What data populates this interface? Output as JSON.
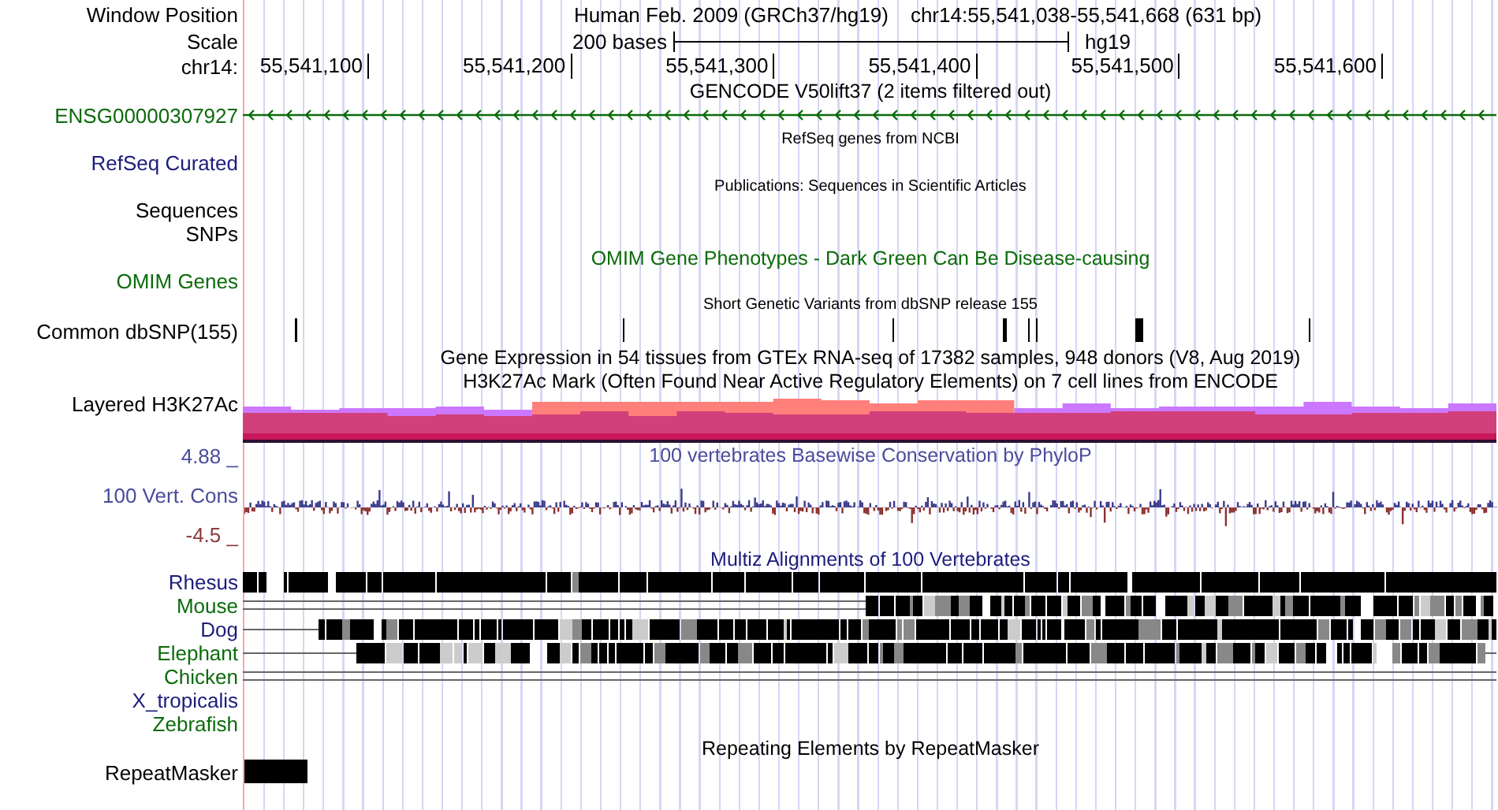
{
  "header": {
    "window_position_label": "Window Position",
    "assembly": "Human Feb. 2009 (GRCh37/hg19)",
    "position": "chr14:55,541,038-55,541,668 (631 bp)",
    "scale_label": "Scale",
    "scale_text": "200 bases",
    "scale_db": "hg19",
    "ruler_label": "chr14:",
    "ticks": [
      "55,541,100",
      "55,541,200",
      "55,541,300",
      "55,541,400",
      "55,541,500",
      "55,541,600"
    ]
  },
  "tracks": [
    {
      "kind": "title",
      "text": "GENCODE V50lift37 (2 items filtered out)",
      "color": "#000000"
    },
    {
      "kind": "gene",
      "label": "ENSG00000307927",
      "color": "#0b6b0b"
    },
    {
      "kind": "caption",
      "text": "RefSeq genes from NCBI",
      "color": "#000000"
    },
    {
      "kind": "label",
      "label": "RefSeq Curated",
      "color": "#1c1c7c"
    },
    {
      "kind": "caption",
      "text": "Publications: Sequences in Scientific Articles",
      "color": "#000000"
    },
    {
      "kind": "label",
      "label": "Sequences",
      "color": "#000000"
    },
    {
      "kind": "label",
      "label": "SNPs",
      "color": "#000000"
    },
    {
      "kind": "title",
      "text": "OMIM Gene Phenotypes - Dark Green Can Be Disease-causing",
      "color": "#0b6b0b"
    },
    {
      "kind": "label",
      "label": "OMIM Genes",
      "color": "#0b6b0b"
    },
    {
      "kind": "caption",
      "text": "Short Genetic Variants from dbSNP release 155",
      "color": "#000000"
    },
    {
      "kind": "snp",
      "label": "Common dbSNP(155)",
      "color": "#000000"
    },
    {
      "kind": "title",
      "text": "Gene Expression in 54 tissues from GTEx RNA-seq of 17382 samples, 948 donors (V8, Aug 2019)",
      "color": "#000000"
    },
    {
      "kind": "title",
      "text": "H3K27Ac Mark (Often Found Near Active Regulatory Elements) on 7 cell lines from ENCODE",
      "color": "#000000"
    },
    {
      "kind": "chart",
      "label": "Layered H3K27Ac",
      "color": "#000000"
    },
    {
      "kind": "wiggle",
      "title": "100 vertebrates Basewise Conservation by PhyloP",
      "max_label": "4.88 _",
      "label": "100 Vert. Cons",
      "min_label": "-4.5 _",
      "color": "#4b4b9c"
    },
    {
      "kind": "title",
      "text": "Multiz Alignments of 100 Vertebrates",
      "color": "#1c1c7c"
    },
    {
      "kind": "species",
      "label": "Rhesus",
      "color": "#1c1c7c"
    },
    {
      "kind": "species",
      "label": "Mouse",
      "color": "#0b6b0b"
    },
    {
      "kind": "species",
      "label": "Dog",
      "color": "#1c1c7c"
    },
    {
      "kind": "species",
      "label": "Elephant",
      "color": "#0b6b0b"
    },
    {
      "kind": "species",
      "label": "Chicken",
      "color": "#0b6b0b"
    },
    {
      "kind": "species",
      "label": "X_tropicalis",
      "color": "#1c1c7c"
    },
    {
      "kind": "species",
      "label": "Zebrafish",
      "color": "#0b6b0b"
    },
    {
      "kind": "title",
      "text": "Repeating Elements by RepeatMasker",
      "color": "#000000"
    },
    {
      "kind": "repeat",
      "label": "RepeatMasker",
      "color": "#000000"
    }
  ]
}
